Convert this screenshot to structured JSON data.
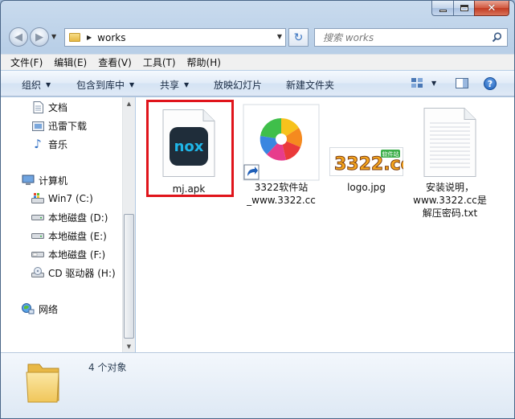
{
  "window": {
    "address_path": "works",
    "search_placeholder": "搜索 works"
  },
  "menu": [
    {
      "id": "file",
      "label": "文件(F)"
    },
    {
      "id": "edit",
      "label": "编辑(E)"
    },
    {
      "id": "view",
      "label": "查看(V)"
    },
    {
      "id": "tools",
      "label": "工具(T)"
    },
    {
      "id": "help",
      "label": "帮助(H)"
    }
  ],
  "toolbar": {
    "organize": "组织",
    "include_library": "包含到库中",
    "share": "共享",
    "slideshow": "放映幻灯片",
    "new_folder": "新建文件夹"
  },
  "nav": {
    "documents": "文档",
    "xunlei": "迅雷下载",
    "music": "音乐",
    "computer": "计算机",
    "drive_c": "Win7 (C:)",
    "drive_d": "本地磁盘 (D:)",
    "drive_e": "本地磁盘 (E:)",
    "drive_f": "本地磁盘 (F:)",
    "drive_h": "CD 驱动器 (H:)",
    "network": "网络"
  },
  "files": [
    {
      "name": "mj.apk",
      "icon": "nox-app-icon",
      "selected_highlight": true
    },
    {
      "name_line1": "3322软件站",
      "name_line2": "_www.3322.cc",
      "icon": "pinwheel-shortcut-icon"
    },
    {
      "name": "logo.jpg",
      "icon": "logo-image-thumbnail",
      "logo_text": "3322.cc",
      "logo_badge": "软件站"
    },
    {
      "name_line1": "安装说明，",
      "name_line2": "www.3322.cc是",
      "name_line3": "解压密码.txt",
      "icon": "text-file-icon"
    }
  ],
  "nox_logo_text": "nox",
  "details": {
    "count": "4 个对象"
  },
  "colors": {
    "selection_border": "#e0141b",
    "nox_bg": "#1f2d3a",
    "nox_accent": "#1fb6e8"
  }
}
